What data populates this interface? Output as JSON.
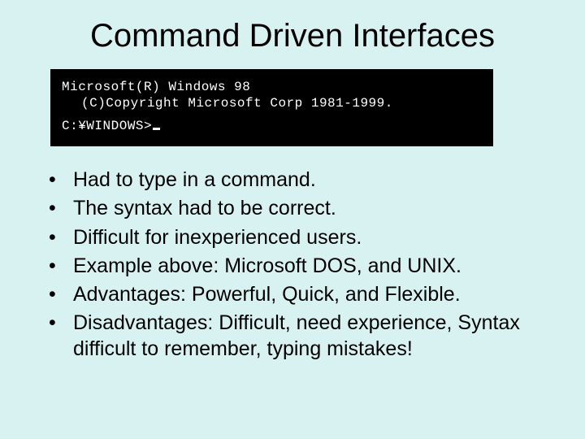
{
  "title": "Command Driven Interfaces",
  "terminal": {
    "line1": "Microsoft(R) Windows 98",
    "line2": "(C)Copyright Microsoft Corp 1981-1999.",
    "prompt": "C:¥WINDOWS>"
  },
  "bullets": [
    "Had to type in a command.",
    "The syntax had to be correct.",
    "Difficult for inexperienced users.",
    "Example above: Microsoft DOS, and UNIX.",
    "Advantages: Powerful, Quick, and Flexible.",
    "Disadvantages: Difficult, need experience, Syntax difficult to remember, typing mistakes!"
  ]
}
